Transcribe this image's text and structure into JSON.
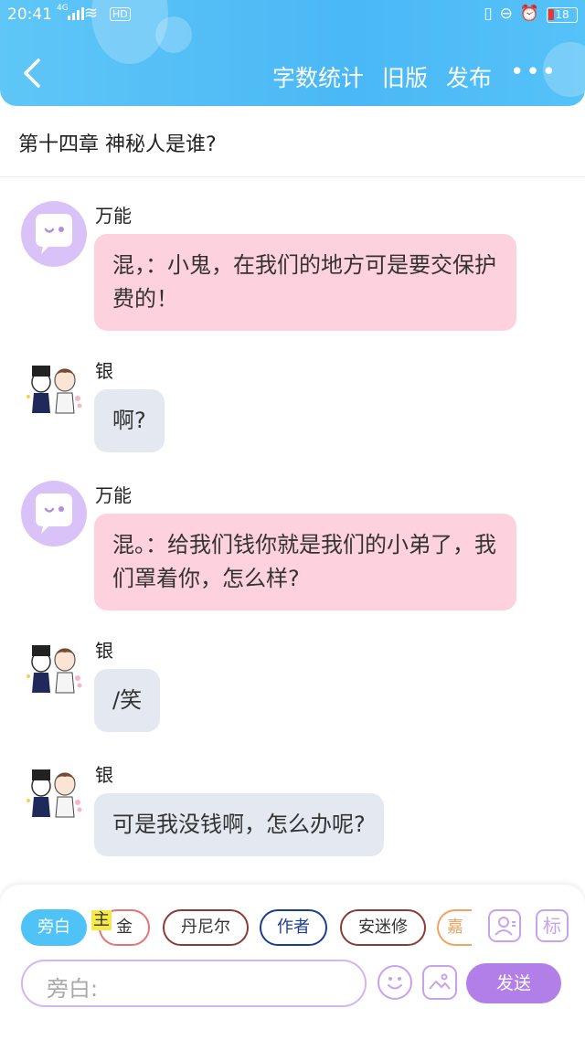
{
  "status_bar": {
    "time": "20:41",
    "network": "4G",
    "hd": "HD",
    "battery": "18"
  },
  "nav": {
    "actions": [
      "字数统计",
      "旧版",
      "发布"
    ],
    "more": "•••"
  },
  "chapter_title": "第十四章 神秘人是谁?",
  "messages": [
    {
      "sender": "万能",
      "text": "混，：小鬼，在我们的地方可是要交保护费的！",
      "style": "pink",
      "avatar": "chat-bubble-avatar"
    },
    {
      "sender": "银",
      "text": "啊?",
      "style": "grey",
      "avatar": "anime-avatar"
    },
    {
      "sender": "万能",
      "text": "混。：给我们钱你就是我们的小弟了，我们罩着你，怎么样?",
      "style": "pink",
      "avatar": "chat-bubble-avatar"
    },
    {
      "sender": "银",
      "text": "/笑",
      "style": "grey",
      "avatar": "anime-avatar"
    },
    {
      "sender": "银",
      "text": "可是我没钱啊，怎么办呢?",
      "style": "grey",
      "avatar": "anime-avatar"
    }
  ],
  "roles": [
    {
      "label": "旁白",
      "active": true
    },
    {
      "label": "金"
    },
    {
      "label": "丹尼尔"
    },
    {
      "label": "作者"
    },
    {
      "label": "安迷修"
    },
    {
      "label": "嘉"
    }
  ],
  "main_marker": "主",
  "input": {
    "placeholder": "旁白:"
  },
  "send_label": "发送",
  "tool_labels": {
    "tag": "标"
  },
  "colors": {
    "header": "#4ab8f6",
    "pink_bubble": "#fdd2de",
    "grey_bubble": "#e4e9f1",
    "accent_purple": "#b27ee8"
  }
}
